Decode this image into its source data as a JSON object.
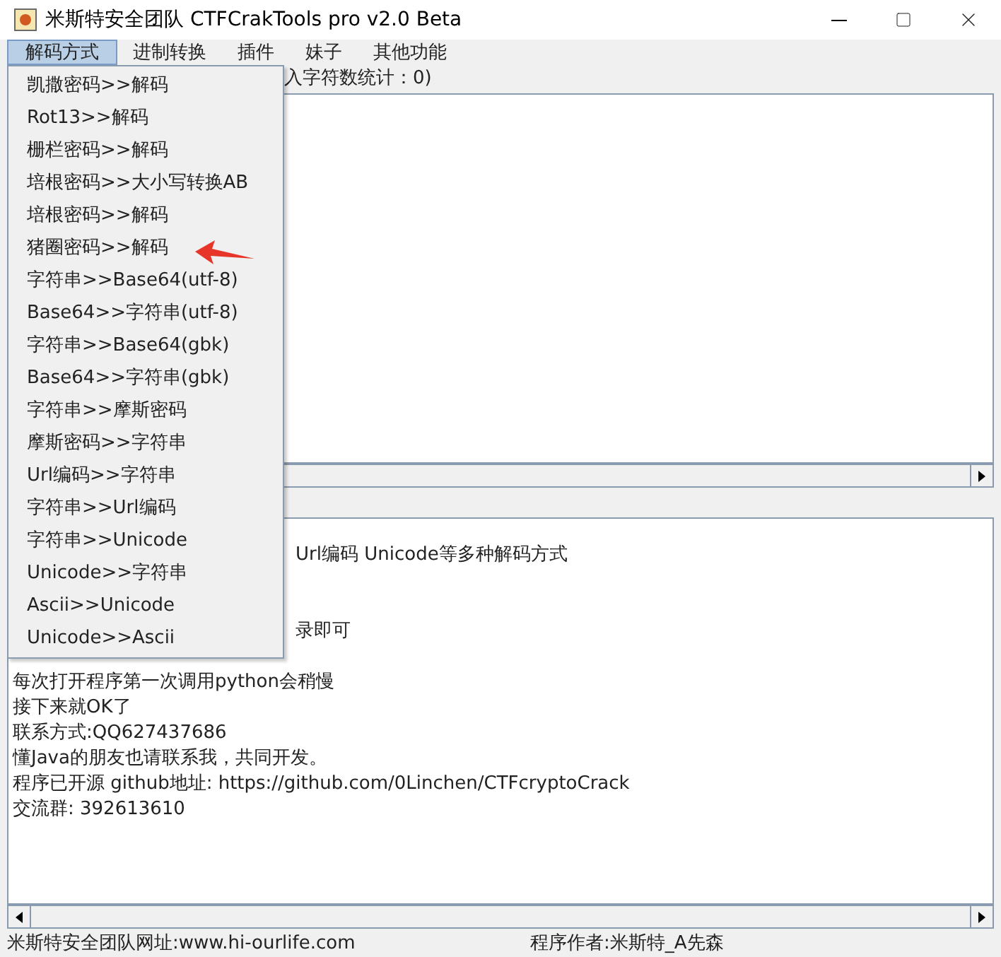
{
  "window": {
    "title": "米斯特安全团队 CTFCrakTools pro v2.0 Beta"
  },
  "menu_bar": [
    {
      "label": "解码方式",
      "selected": true
    },
    {
      "label": "进制转换",
      "selected": false
    },
    {
      "label": "插件",
      "selected": false
    },
    {
      "label": "妹子",
      "selected": false
    },
    {
      "label": "其他功能",
      "selected": false
    }
  ],
  "dropdown": [
    "凯撒密码>>解码",
    "Rot13>>解码",
    "栅栏密码>>解码",
    "培根密码>>大小写转换AB",
    "培根密码>>解码",
    "猪圈密码>>解码",
    "字符串>>Base64(utf-8)",
    "Base64>>字符串(utf-8)",
    "字符串>>Base64(gbk)",
    "Base64>>字符串(gbk)",
    "字符串>>摩斯密码",
    "摩斯密码>>字符串",
    "Url编码>>字符串",
    "字符串>>Url编码",
    "字符串>>Unicode",
    "Unicode>>字符串",
    "Ascii>>Unicode",
    "Unicode>>Ascii"
  ],
  "input_panel": {
    "label": "入字符数统计：0)"
  },
  "output_lines": [
    {
      "kind": "covered",
      "text": "Url编码 Unicode等多种解码方式"
    },
    {
      "kind": "blank"
    },
    {
      "kind": "blank"
    },
    {
      "kind": "covered",
      "text": "录即可"
    },
    {
      "kind": "blank"
    },
    {
      "kind": "text",
      "text": "每次打开程序第一次调用python会稍慢"
    },
    {
      "kind": "text",
      "text": "接下来就OK了"
    },
    {
      "kind": "text",
      "text": "联系方式:QQ627437686"
    },
    {
      "kind": "text",
      "text": "懂Java的朋友也请联系我，共同开发。"
    },
    {
      "kind": "text",
      "text": "程序已开源 github地址: https://github.com/0Linchen/CTFcryptoCrack"
    },
    {
      "kind": "text",
      "text": "交流群: 392613610"
    }
  ],
  "status_bar": {
    "left": "米斯特安全团队网址:www.hi-ourlife.com",
    "right": "程序作者:米斯特_A先森"
  }
}
